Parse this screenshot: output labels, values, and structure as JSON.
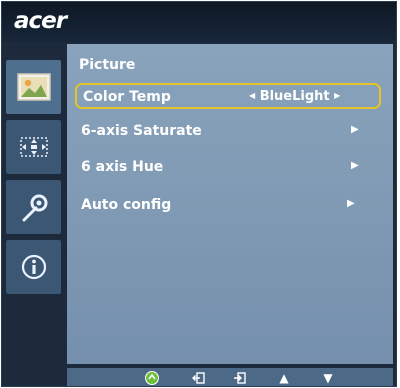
{
  "brand": {
    "logo_text": "acer"
  },
  "sidebar": {
    "items": [
      {
        "id": "picture",
        "icon": "picture-icon",
        "active": true
      },
      {
        "id": "position",
        "icon": "osd-position-icon",
        "active": false
      },
      {
        "id": "settings",
        "icon": "wrench-gear-icon",
        "active": false
      },
      {
        "id": "information",
        "icon": "info-icon",
        "active": false
      }
    ]
  },
  "menu": {
    "title": "Picture",
    "items": [
      {
        "label": "Color Temp",
        "value": "BlueLight",
        "selected": true
      },
      {
        "label": "6-axis Saturate",
        "value": "",
        "selected": false
      },
      {
        "label": "6 axis Hue",
        "value": "",
        "selected": false
      },
      {
        "label": "Auto config",
        "value": "",
        "selected": false
      }
    ]
  },
  "bottom_bar": {
    "icons": [
      "auto-icon",
      "exit-icon",
      "enter-icon",
      "up-arrow-icon",
      "down-arrow-icon"
    ]
  },
  "colors": {
    "panel": "#8aa3bc",
    "frame": "#1c2a3c",
    "highlight": "#e4c428"
  }
}
